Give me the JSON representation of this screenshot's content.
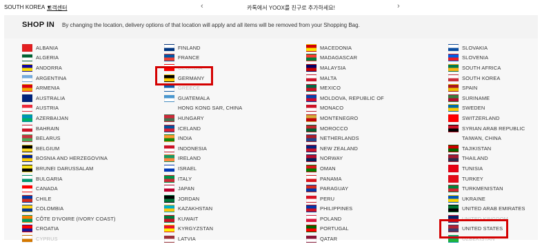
{
  "topbar": {
    "region": "SOUTH KOREA",
    "customer_service": "고객센터",
    "promo": "카톡에서 YOOX를 친구로 추가하세요!"
  },
  "header": {
    "title": "SHOP IN",
    "description": "By changing the location, delivery options of that location will apply and all items will be removed from your Shopping Bag."
  },
  "countries": {
    "col1": [
      {
        "name": "ALBANIA",
        "c1": "#e41e20",
        "c2": "#e41e20"
      },
      {
        "name": "ALGERIA",
        "c1": "#006233",
        "c2": "#ffffff"
      },
      {
        "name": "ANDORRA",
        "c1": "#10069f",
        "c2": "#fedf00"
      },
      {
        "name": "ARGENTINA",
        "c1": "#74acdf",
        "c2": "#ffffff"
      },
      {
        "name": "ARMENIA",
        "c1": "#d90012",
        "c2": "#f2a800"
      },
      {
        "name": "AUSTRALIA",
        "c1": "#00247d",
        "c2": "#00247d"
      },
      {
        "name": "AUSTRIA",
        "c1": "#ed2939",
        "c2": "#ffffff"
      },
      {
        "name": "AZERBAIJAN",
        "c1": "#0092bc",
        "c2": "#00af66"
      },
      {
        "name": "BAHRAIN",
        "c1": "#ffffff",
        "c2": "#ce1126"
      },
      {
        "name": "BELARUS",
        "c1": "#c8313e",
        "c2": "#4aa657"
      },
      {
        "name": "BELGIUM",
        "c1": "#000000",
        "c2": "#fdda24"
      },
      {
        "name": "BOSNIA AND HERZEGOVINA",
        "c1": "#002395",
        "c2": "#fecb00"
      },
      {
        "name": "BRUNEI DARUSSALAM",
        "c1": "#f7e017",
        "c2": "#000000"
      },
      {
        "name": "BULGARIA",
        "c1": "#ffffff",
        "c2": "#00966e"
      },
      {
        "name": "CANADA",
        "c1": "#ff0000",
        "c2": "#ffffff"
      },
      {
        "name": "CHILE",
        "c1": "#0039a6",
        "c2": "#d52b1e"
      },
      {
        "name": "COLOMBIA",
        "c1": "#fcd116",
        "c2": "#003893"
      },
      {
        "name": "CÔTE D'IVOIRE (IVORY COAST)",
        "c1": "#f77f00",
        "c2": "#009e60"
      },
      {
        "name": "CROATIA",
        "c1": "#ff0000",
        "c2": "#171796"
      },
      {
        "name": "CYPRUS",
        "c1": "#ffffff",
        "c2": "#d57800",
        "faded": true
      }
    ],
    "col2": [
      {
        "name": "FINLAND",
        "c1": "#ffffff",
        "c2": "#003580"
      },
      {
        "name": "FRANCE",
        "c1": "#0055a4",
        "c2": "#ef4135"
      },
      {
        "name": "GEORGIA",
        "c1": "#ffffff",
        "c2": "#ff0000",
        "faded": true
      },
      {
        "name": "GERMANY",
        "c1": "#000000",
        "c2": "#ffce00"
      },
      {
        "name": "GREECE",
        "c1": "#0d5eaf",
        "c2": "#ffffff",
        "faded": true
      },
      {
        "name": "GUATEMALA",
        "c1": "#4997d0",
        "c2": "#ffffff"
      },
      {
        "name": "HONG KONG SAR, CHINA",
        "c1": "",
        "c2": ""
      },
      {
        "name": "HUNGARY",
        "c1": "#ce2939",
        "c2": "#477050"
      },
      {
        "name": "ICELAND",
        "c1": "#02529c",
        "c2": "#dc1e35"
      },
      {
        "name": "INDIA",
        "c1": "#ff9933",
        "c2": "#138808"
      },
      {
        "name": "INDONESIA",
        "c1": "#ce1126",
        "c2": "#ffffff"
      },
      {
        "name": "IRELAND",
        "c1": "#169b62",
        "c2": "#ff883e"
      },
      {
        "name": "ISRAEL",
        "c1": "#ffffff",
        "c2": "#0038b8"
      },
      {
        "name": "ITALY",
        "c1": "#009246",
        "c2": "#ce2b37"
      },
      {
        "name": "JAPAN",
        "c1": "#ffffff",
        "c2": "#bc002d"
      },
      {
        "name": "JORDAN",
        "c1": "#000000",
        "c2": "#007a3d"
      },
      {
        "name": "KAZAKHSTAN",
        "c1": "#00afca",
        "c2": "#fec50c"
      },
      {
        "name": "KUWAIT",
        "c1": "#007a3d",
        "c2": "#ce1126"
      },
      {
        "name": "KYRGYZSTAN",
        "c1": "#e8112d",
        "c2": "#ffef00"
      },
      {
        "name": "LATVIA",
        "c1": "#9e3039",
        "c2": "#ffffff"
      }
    ],
    "col3": [
      {
        "name": "MACEDONIA",
        "c1": "#d20000",
        "c2": "#ffe600"
      },
      {
        "name": "MADAGASCAR",
        "c1": "#fc3d32",
        "c2": "#007e3a"
      },
      {
        "name": "MALAYSIA",
        "c1": "#010066",
        "c2": "#cc0001"
      },
      {
        "name": "MALTA",
        "c1": "#ffffff",
        "c2": "#cf142b"
      },
      {
        "name": "MEXICO",
        "c1": "#006847",
        "c2": "#ce1126"
      },
      {
        "name": "MOLDOVA, REPUBLIC OF",
        "c1": "#0046ae",
        "c2": "#cc092f"
      },
      {
        "name": "MONACO",
        "c1": "#ce1126",
        "c2": "#ffffff"
      },
      {
        "name": "MONTENEGRO",
        "c1": "#d3ae3b",
        "c2": "#c40308"
      },
      {
        "name": "MOROCCO",
        "c1": "#c1272d",
        "c2": "#006233"
      },
      {
        "name": "NETHERLANDS",
        "c1": "#ae1c28",
        "c2": "#21468b"
      },
      {
        "name": "NEW ZEALAND",
        "c1": "#00247d",
        "c2": "#cc142b"
      },
      {
        "name": "NORWAY",
        "c1": "#ba0c2f",
        "c2": "#00205b"
      },
      {
        "name": "OMAN",
        "c1": "#db161b",
        "c2": "#008000"
      },
      {
        "name": "PANAMA",
        "c1": "#ffffff",
        "c2": "#da121a"
      },
      {
        "name": "PARAGUAY",
        "c1": "#d52b1e",
        "c2": "#0038a8"
      },
      {
        "name": "PERU",
        "c1": "#d91023",
        "c2": "#ffffff"
      },
      {
        "name": "PHILIPPINES",
        "c1": "#0038a8",
        "c2": "#ce1126"
      },
      {
        "name": "POLAND",
        "c1": "#ffffff",
        "c2": "#dc143c"
      },
      {
        "name": "PORTUGAL",
        "c1": "#006600",
        "c2": "#ff0000"
      },
      {
        "name": "QATAR",
        "c1": "#8a1538",
        "c2": "#ffffff"
      }
    ],
    "col4": [
      {
        "name": "SLOVAKIA",
        "c1": "#ffffff",
        "c2": "#0b4ea2"
      },
      {
        "name": "SLOVENIA",
        "c1": "#005ce5",
        "c2": "#ed1c24"
      },
      {
        "name": "SOUTH AFRICA",
        "c1": "#007a4d",
        "c2": "#ffb612"
      },
      {
        "name": "SOUTH KOREA",
        "c1": "#ffffff",
        "c2": "#cd2e3a"
      },
      {
        "name": "SPAIN",
        "c1": "#aa151b",
        "c2": "#f1bf00"
      },
      {
        "name": "SURINAME",
        "c1": "#377e3f",
        "c2": "#b40a2d"
      },
      {
        "name": "SWEDEN",
        "c1": "#006aa7",
        "c2": "#fecc00"
      },
      {
        "name": "SWITZERLAND",
        "c1": "#ff0000",
        "c2": "#ff0000"
      },
      {
        "name": "SYRIAN ARAB REPUBLIC",
        "c1": "#ce1126",
        "c2": "#000000"
      },
      {
        "name": "TAIWAN, CHINA",
        "c1": "",
        "c2": ""
      },
      {
        "name": "TAJIKISTAN",
        "c1": "#cc0000",
        "c2": "#006600"
      },
      {
        "name": "THAILAND",
        "c1": "#a51931",
        "c2": "#2d2a4a"
      },
      {
        "name": "TUNISIA",
        "c1": "#e70013",
        "c2": "#e70013"
      },
      {
        "name": "TURKEY",
        "c1": "#e30a17",
        "c2": "#e30a17"
      },
      {
        "name": "TURKMENISTAN",
        "c1": "#00843d",
        "c2": "#d22630"
      },
      {
        "name": "UKRAINE",
        "c1": "#0057b7",
        "c2": "#ffd700"
      },
      {
        "name": "UNITED ARAB EMIRATES",
        "c1": "#00732f",
        "c2": "#000000"
      },
      {
        "name": "UNITED KINGDOM",
        "c1": "#012169",
        "c2": "#c8102e",
        "faded": true
      },
      {
        "name": "UNITED STATES",
        "c1": "#b22234",
        "c2": "#3c3b6e"
      },
      {
        "name": "UZBEKISTAN",
        "c1": "#0099b5",
        "c2": "#1eb53a",
        "faded": true
      }
    ]
  },
  "highlight_color": "#d40000"
}
